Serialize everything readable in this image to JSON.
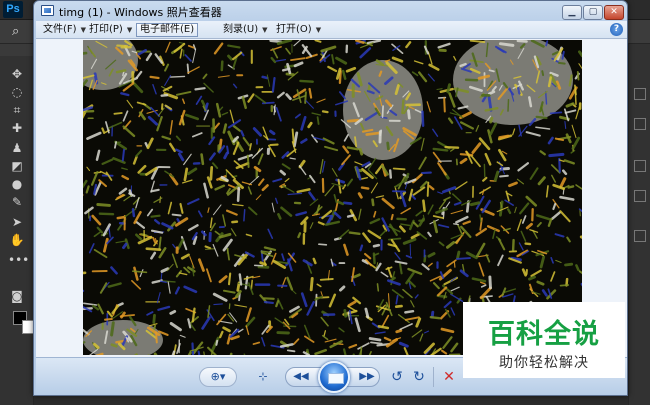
{
  "photoshop": {
    "logo": "Ps",
    "search_icon": "search-icon",
    "tools": [
      "move-icon",
      "lasso-icon",
      "crop-icon",
      "healing-icon",
      "stamp-icon",
      "eraser-icon",
      "blur-icon",
      "pen-icon",
      "select-icon",
      "hand-icon",
      "more-icon"
    ],
    "foreground_color": "#000000",
    "background_color": "#ffffff"
  },
  "window": {
    "title": "timg (1) - Windows 照片查看器",
    "buttons": {
      "minimize": "minimize-icon",
      "maximize": "maximize-icon",
      "close": "close-icon"
    }
  },
  "menu": {
    "items": [
      {
        "label": "文件(F)",
        "has_arrow": true
      },
      {
        "label": "打印(P)",
        "has_arrow": true
      },
      {
        "label": "电子邮件(E)",
        "has_arrow": false,
        "active": true
      },
      {
        "label": "刻录(U)",
        "has_arrow": true
      },
      {
        "label": "打开(O)",
        "has_arrow": true
      }
    ],
    "help": "?"
  },
  "image": {
    "description_icon": "embossed-noise-photo",
    "palette": [
      "#0a0a05",
      "#d6c236",
      "#e39a25",
      "#2a3ab8",
      "#7e8f25",
      "#d8d8d0",
      "#4d6a18"
    ]
  },
  "controls": {
    "zoom": "zoom-icon",
    "fit": "actual-size-icon",
    "previous": "previous-icon",
    "slideshow": "slideshow-icon",
    "next": "next-icon",
    "rotate_left": "rotate-counterclockwise-icon",
    "rotate_right": "rotate-clockwise-icon",
    "delete": "delete-icon"
  },
  "watermark": {
    "title": "百科全说",
    "subtitle": "助你轻松解决",
    "color": "#16a043"
  }
}
